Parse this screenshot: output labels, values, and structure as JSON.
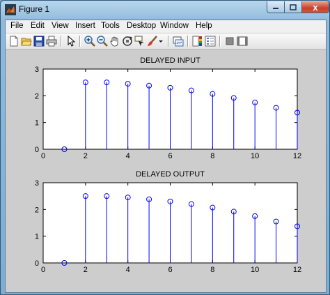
{
  "window": {
    "title": "Figure 1",
    "close_label": "x",
    "icon": "matlab-logo-icon"
  },
  "menubar": {
    "items": [
      "File",
      "Edit",
      "View",
      "Insert",
      "Tools",
      "Desktop",
      "Window",
      "Help"
    ]
  },
  "toolbar": {
    "icons": [
      "new-figure-icon",
      "open-file-icon",
      "save-icon",
      "print-icon",
      "edit-plot-arrow-icon",
      "zoom-in-icon",
      "zoom-out-icon",
      "pan-hand-icon",
      "rotate-3d-icon",
      "data-cursor-icon",
      "brush-icon",
      "brush-dropdown-icon",
      "link-plot-icon",
      "insert-colorbar-icon",
      "insert-legend-icon",
      "hide-plot-tools-icon",
      "show-plot-tools-icon"
    ]
  },
  "colors": {
    "stem": "#0000ff",
    "figure_bg": "#cdcdcd",
    "axes_bg": "#ffffff"
  },
  "chart_data": [
    {
      "type": "stem",
      "title": "DELAYED INPUT",
      "x": [
        1,
        2,
        3,
        4,
        5,
        6,
        7,
        8,
        9,
        10,
        11,
        12
      ],
      "y": [
        0,
        2.5,
        2.5,
        2.45,
        2.38,
        2.3,
        2.2,
        2.07,
        1.92,
        1.75,
        1.55,
        1.37
      ],
      "xlim": [
        0,
        12
      ],
      "ylim": [
        0,
        3
      ],
      "xticks": [
        "0",
        "2",
        "4",
        "6",
        "8",
        "10",
        "12"
      ],
      "yticks": [
        "0",
        "1",
        "2",
        "3"
      ],
      "grid": false
    },
    {
      "type": "stem",
      "title": "DELAYED OUTPUT",
      "x": [
        1,
        2,
        3,
        4,
        5,
        6,
        7,
        8,
        9,
        10,
        11,
        12
      ],
      "y": [
        0,
        2.5,
        2.5,
        2.45,
        2.38,
        2.3,
        2.2,
        2.07,
        1.92,
        1.75,
        1.55,
        1.37
      ],
      "xlim": [
        0,
        12
      ],
      "ylim": [
        0,
        3
      ],
      "xticks": [
        "0",
        "2",
        "4",
        "6",
        "8",
        "10",
        "12"
      ],
      "yticks": [
        "0",
        "1",
        "2",
        "3"
      ],
      "grid": false
    }
  ]
}
